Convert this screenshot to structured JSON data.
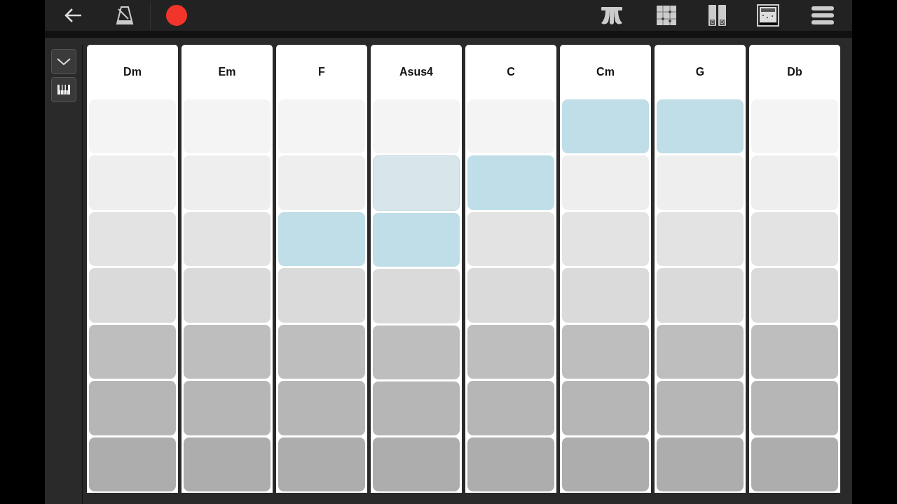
{
  "toolbar": {
    "icon_labels": [
      "C",
      "D"
    ]
  },
  "columns": [
    {
      "chord": "Dm",
      "pads": [
        {
          "lit": false,
          "faint": false
        },
        {
          "lit": false,
          "faint": false
        },
        {
          "lit": false,
          "faint": false
        },
        {
          "lit": false,
          "faint": false
        },
        {
          "lit": false,
          "faint": false
        },
        {
          "lit": false,
          "faint": false
        },
        {
          "lit": false,
          "faint": false
        }
      ]
    },
    {
      "chord": "Em",
      "pads": [
        {
          "lit": false,
          "faint": false
        },
        {
          "lit": false,
          "faint": false
        },
        {
          "lit": false,
          "faint": false
        },
        {
          "lit": false,
          "faint": false
        },
        {
          "lit": false,
          "faint": false
        },
        {
          "lit": false,
          "faint": false
        },
        {
          "lit": false,
          "faint": false
        }
      ]
    },
    {
      "chord": "F",
      "pads": [
        {
          "lit": false,
          "faint": false
        },
        {
          "lit": false,
          "faint": false
        },
        {
          "lit": true,
          "faint": false
        },
        {
          "lit": false,
          "faint": false
        },
        {
          "lit": false,
          "faint": false
        },
        {
          "lit": false,
          "faint": false
        },
        {
          "lit": false,
          "faint": false
        }
      ]
    },
    {
      "chord": "Asus4",
      "pads": [
        {
          "lit": false,
          "faint": false
        },
        {
          "lit": false,
          "faint": true
        },
        {
          "lit": true,
          "faint": false
        },
        {
          "lit": false,
          "faint": false
        },
        {
          "lit": false,
          "faint": false
        },
        {
          "lit": false,
          "faint": false
        },
        {
          "lit": false,
          "faint": false
        }
      ]
    },
    {
      "chord": "C",
      "pads": [
        {
          "lit": false,
          "faint": false
        },
        {
          "lit": true,
          "faint": false
        },
        {
          "lit": false,
          "faint": false
        },
        {
          "lit": false,
          "faint": false
        },
        {
          "lit": false,
          "faint": false
        },
        {
          "lit": false,
          "faint": false
        },
        {
          "lit": false,
          "faint": false
        }
      ]
    },
    {
      "chord": "Cm",
      "pads": [
        {
          "lit": true,
          "faint": false
        },
        {
          "lit": false,
          "faint": false
        },
        {
          "lit": false,
          "faint": false
        },
        {
          "lit": false,
          "faint": false
        },
        {
          "lit": false,
          "faint": false
        },
        {
          "lit": false,
          "faint": false
        },
        {
          "lit": false,
          "faint": false
        }
      ]
    },
    {
      "chord": "G",
      "pads": [
        {
          "lit": true,
          "faint": false
        },
        {
          "lit": false,
          "faint": false
        },
        {
          "lit": false,
          "faint": false
        },
        {
          "lit": false,
          "faint": false
        },
        {
          "lit": false,
          "faint": false
        },
        {
          "lit": false,
          "faint": false
        },
        {
          "lit": false,
          "faint": false
        }
      ]
    },
    {
      "chord": "Db",
      "pads": [
        {
          "lit": false,
          "faint": false
        },
        {
          "lit": false,
          "faint": false
        },
        {
          "lit": false,
          "faint": false
        },
        {
          "lit": false,
          "faint": false
        },
        {
          "lit": false,
          "faint": false
        },
        {
          "lit": false,
          "faint": false
        },
        {
          "lit": false,
          "faint": false
        }
      ]
    }
  ]
}
